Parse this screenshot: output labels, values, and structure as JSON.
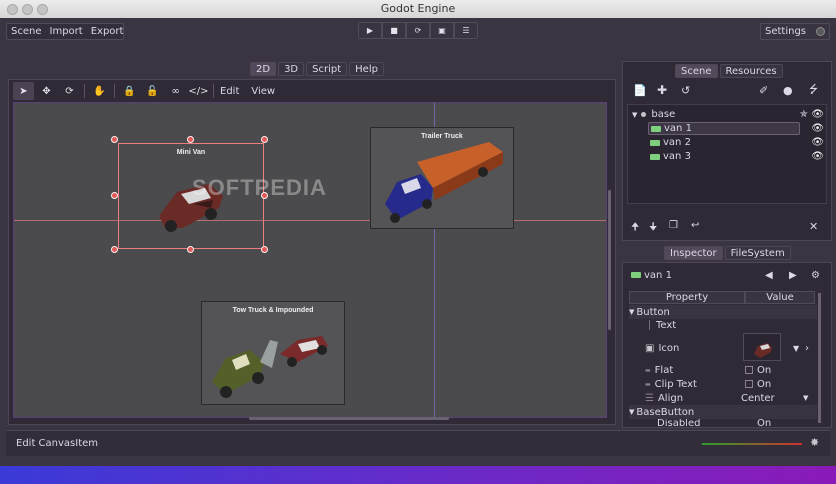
{
  "window": {
    "title": "Godot Engine"
  },
  "menubar": {
    "items": [
      "Scene",
      "Import",
      "Export"
    ],
    "settings_label": "Settings"
  },
  "main_tabs": [
    "2D",
    "3D",
    "Script",
    "Help"
  ],
  "viewport": {
    "toolbar_menus": [
      "Edit",
      "View"
    ],
    "sprites": [
      {
        "label": "Mini Van"
      },
      {
        "label": "Trailer Truck"
      },
      {
        "label": "Tow Truck & Impounded"
      }
    ],
    "watermark": "SOFTPEDIA"
  },
  "scene_panel": {
    "tabs": [
      "Scene",
      "Resources"
    ],
    "tree": [
      {
        "name": "base",
        "type": "root"
      },
      {
        "name": "van 1",
        "type": "button",
        "selected": true
      },
      {
        "name": "van 2",
        "type": "button"
      },
      {
        "name": "van 3",
        "type": "button"
      }
    ]
  },
  "inspector": {
    "tabs": [
      "Inspector",
      "FileSystem"
    ],
    "object_name": "van 1",
    "headers": {
      "property": "Property",
      "value": "Value"
    },
    "rows": [
      {
        "kind": "section",
        "label": "Button"
      },
      {
        "kind": "prop",
        "label": "Text",
        "value": ""
      },
      {
        "kind": "prop",
        "label": "Icon",
        "value": ""
      },
      {
        "kind": "prop",
        "label": "Flat",
        "value": "On"
      },
      {
        "kind": "prop",
        "label": "Clip Text",
        "value": "On"
      },
      {
        "kind": "prop",
        "label": "Align",
        "value": "Center"
      },
      {
        "kind": "section",
        "label": "BaseButton"
      },
      {
        "kind": "prop",
        "label": "Disabled",
        "value": "On"
      }
    ]
  },
  "statusbar": {
    "text": "Edit CanvasItem"
  },
  "colors": {
    "accent_selection": "#f08080",
    "editor_bg": "#3b3542",
    "panel_bg": "#2f2a35",
    "canvas_bg": "#4b4a4c",
    "node_icon_green": "#7ecf7e"
  }
}
